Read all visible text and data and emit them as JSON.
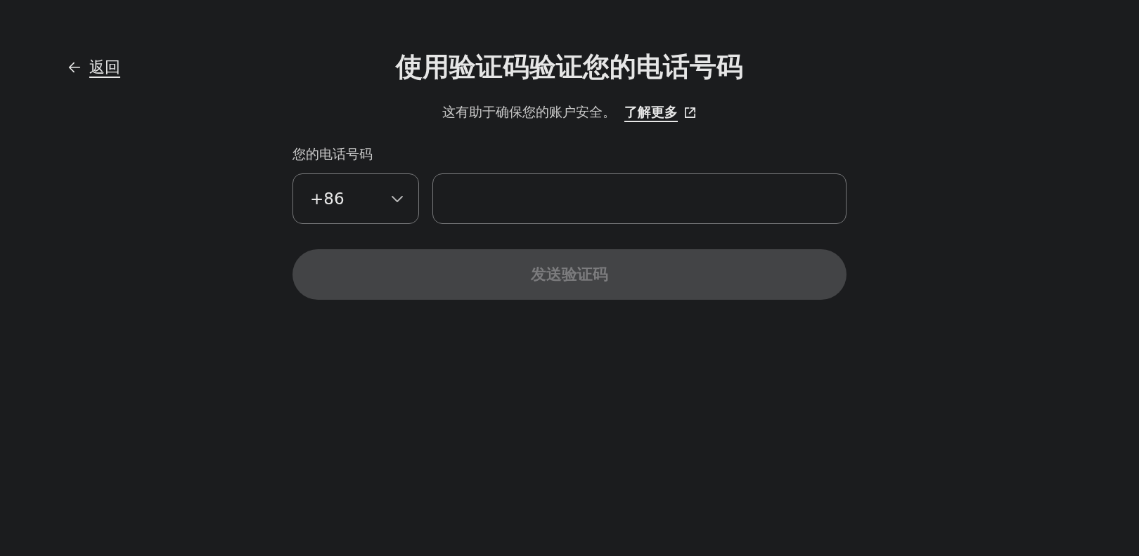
{
  "back_link": {
    "label": "返回"
  },
  "title": "使用验证码验证您的电话号码",
  "subtitle": {
    "text": "这有助于确保您的账户安全。",
    "link": "了解更多"
  },
  "phone": {
    "label": "您的电话号码",
    "country_code": "+86"
  },
  "send_button": {
    "label": "发送验证码",
    "disabled": true
  }
}
